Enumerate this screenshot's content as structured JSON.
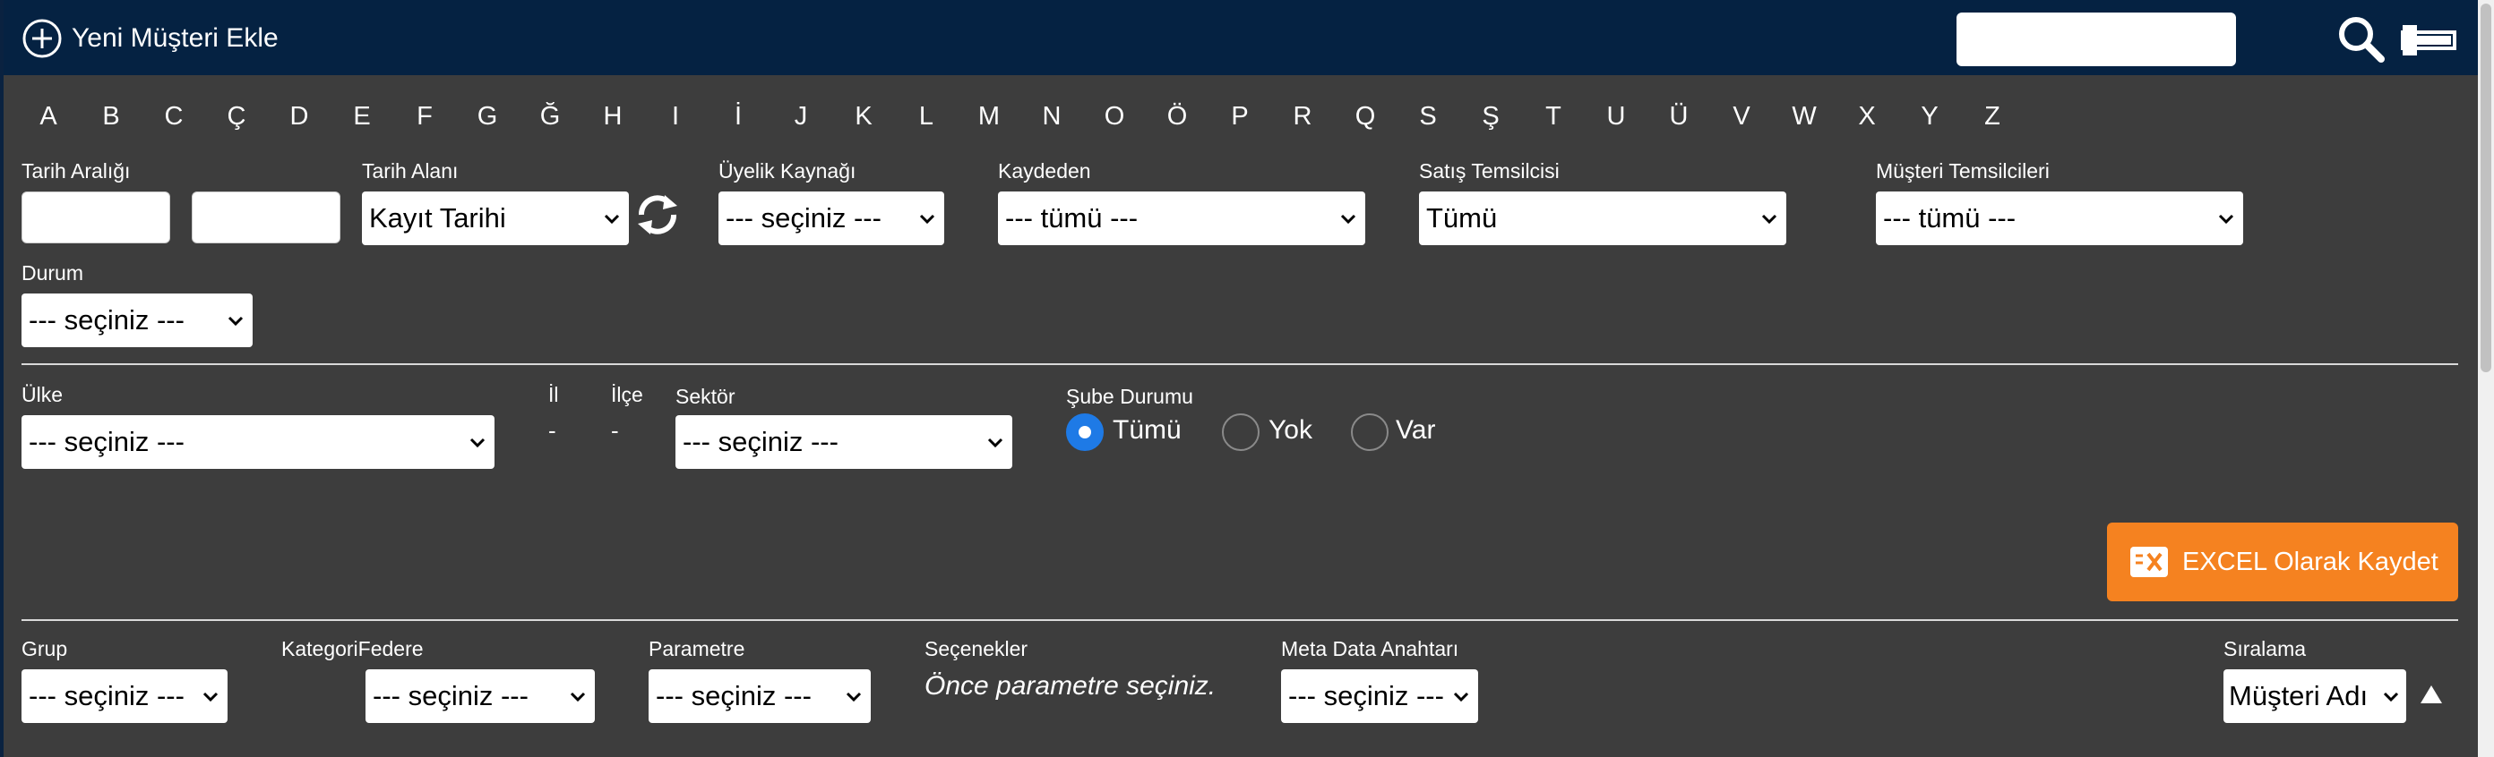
{
  "header": {
    "new_customer_label": "Yeni Müşteri Ekle",
    "search_value": ""
  },
  "alphabet": [
    "A",
    "B",
    "C",
    "Ç",
    "D",
    "E",
    "F",
    "G",
    "Ğ",
    "H",
    "I",
    "İ",
    "J",
    "K",
    "L",
    "M",
    "N",
    "O",
    "Ö",
    "P",
    "R",
    "Q",
    "S",
    "Ş",
    "T",
    "U",
    "Ü",
    "V",
    "W",
    "X",
    "Y",
    "Z"
  ],
  "filters_row1": {
    "date_range_label": "Tarih Aralığı",
    "date_start_value": "",
    "date_end_value": "",
    "date_field_label": "Tarih Alanı",
    "date_field_value": "Kayıt Tarihi",
    "membership_source_label": "Üyelik Kaynağı",
    "membership_source_value": "--- seçiniz ---",
    "recorded_by_label": "Kaydeden",
    "recorded_by_value": "--- tümü ---",
    "sales_rep_label": "Satış Temsilcisi",
    "sales_rep_value": "Tümü",
    "customer_reps_label": "Müşteri Temsilcileri",
    "customer_reps_value": "--- tümü ---",
    "status_label": "Durum",
    "status_value": "--- seçiniz ---"
  },
  "filters_row2": {
    "country_label": "Ülke",
    "country_value": "--- seçiniz ---",
    "province_label": "İl",
    "province_value": "-",
    "district_label": "İlçe",
    "district_value": "-",
    "sector_label": "Sektör",
    "sector_value": "--- seçiniz ---",
    "branch_status_label": "Şube Durumu",
    "branch_options": [
      "Tümü",
      "Yok",
      "Var"
    ],
    "branch_selected": "Tümü"
  },
  "actions": {
    "excel_label": "EXCEL Olarak Kaydet"
  },
  "filters_row3": {
    "group_label": "Grup",
    "group_value": "--- seçiniz ---",
    "category_label": "KategoriFedere",
    "category_value": "--- seçiniz ---",
    "parameter_label": "Parametre",
    "parameter_value": "--- seçiniz ---",
    "options_label": "Seçenekler",
    "options_hint": "Önce parametre seçiniz.",
    "meta_key_label": "Meta Data Anahtarı",
    "meta_key_value": "--- seçiniz ---",
    "sort_label": "Sıralama",
    "sort_value": "Müşteri Adı"
  },
  "colors": {
    "header_bg": "#052242",
    "page_bg": "#3d3d3d",
    "accent_orange": "#f58220",
    "radio_selected": "#1e7ae6"
  }
}
